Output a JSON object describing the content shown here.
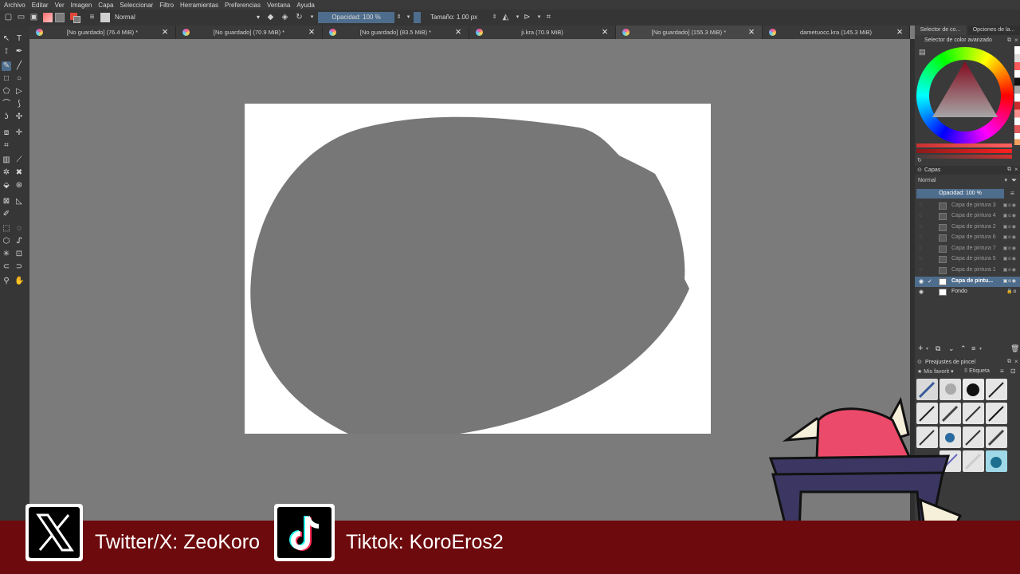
{
  "menu": [
    "Archivo",
    "Editar",
    "Ver",
    "Imagen",
    "Capa",
    "Seleccionar",
    "Filtro",
    "Herramientas",
    "Preferencias",
    "Ventana",
    "Ayuda"
  ],
  "toolbar": {
    "blend_mode": "Normal",
    "opacity_label": "Opacidad: 100 %",
    "size_label": "Tamaño: 1.00 px",
    "fg_color": "#e0483a",
    "bg_color": "#7b7b7b"
  },
  "tabs": [
    {
      "label": "[No guardado]  (76.4 MiB) *"
    },
    {
      "label": "[No guardado]  (70.9 MiB) *"
    },
    {
      "label": "[No guardado]  (83.5 MiB) *"
    },
    {
      "label": "ji.kra (70.9 MiB)"
    },
    {
      "label": "[No guardado]  (155.3 MiB) *"
    },
    {
      "label": "dametuocc.kra  (145.3 MiB)"
    }
  ],
  "docker": {
    "tab_selector": "Selector de co...",
    "tab_options": "Opciones de la...",
    "color_title": "Selector de color avanzado",
    "layers_title": "Capas",
    "layers_blend": "Normal",
    "layers_opacity": "Opacidad:  100 %",
    "layers": [
      {
        "name": "Capa de pintura 3",
        "visible": false,
        "active": false
      },
      {
        "name": "Capa de pintura 4",
        "visible": false,
        "active": false
      },
      {
        "name": "Capa de pintura 2",
        "visible": false,
        "active": false
      },
      {
        "name": "Capa de pintura 6",
        "visible": false,
        "active": false
      },
      {
        "name": "Capa de pintura 7",
        "visible": false,
        "active": false
      },
      {
        "name": "Capa de pintura 5",
        "visible": false,
        "active": false
      },
      {
        "name": "Capa de pintura 1",
        "visible": false,
        "active": false
      },
      {
        "name": "Capa de pintu...",
        "visible": true,
        "active": true
      },
      {
        "name": "Fondo",
        "visible": true,
        "active": false
      }
    ],
    "brush_title": "Preajustes de pincel",
    "brush_filter": "Mis favorit",
    "brush_tag": "Etiqueta"
  },
  "banner": {
    "twitter_text": "Twitter/X: ZeoKoro",
    "tiktok_text": "Tiktok: KoroEros2",
    "color": "#6d0a0d"
  }
}
